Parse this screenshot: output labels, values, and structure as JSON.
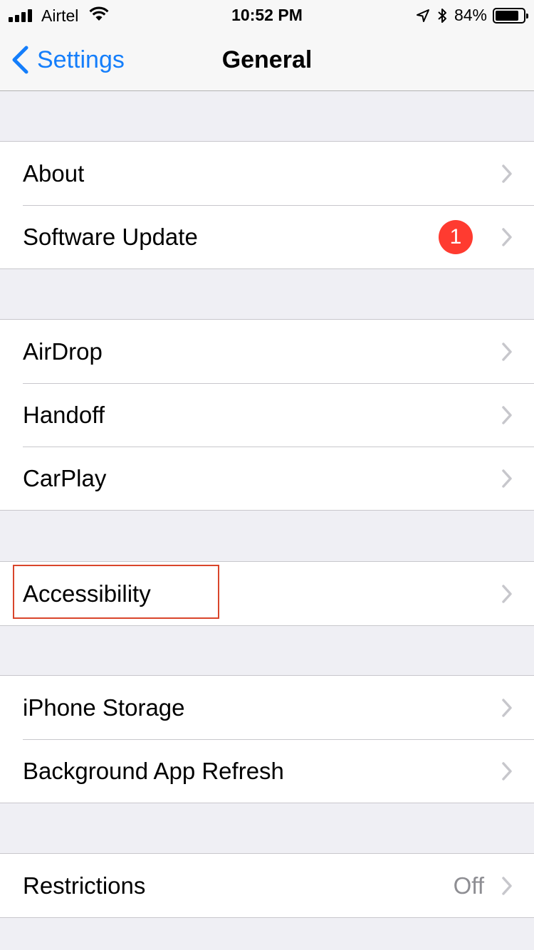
{
  "status_bar": {
    "carrier": "Airtel",
    "time": "10:52 PM",
    "battery_percent": "84%",
    "battery_level": 0.84,
    "icons": [
      "signal-icon",
      "wifi-icon",
      "location-icon",
      "bluetooth-icon",
      "battery-icon"
    ]
  },
  "nav": {
    "back_label": "Settings",
    "title": "General"
  },
  "groups": [
    {
      "items": [
        {
          "label": "About"
        },
        {
          "label": "Software Update",
          "badge": "1"
        }
      ]
    },
    {
      "items": [
        {
          "label": "AirDrop"
        },
        {
          "label": "Handoff"
        },
        {
          "label": "CarPlay"
        }
      ]
    },
    {
      "items": [
        {
          "label": "Accessibility",
          "highlighted": true
        }
      ]
    },
    {
      "items": [
        {
          "label": "iPhone Storage"
        },
        {
          "label": "Background App Refresh"
        }
      ]
    },
    {
      "items": [
        {
          "label": "Restrictions",
          "value": "Off"
        }
      ]
    }
  ],
  "colors": {
    "accent": "#147efb",
    "badge": "#ff3b30",
    "background": "#efeff4",
    "highlight": "#d9452b"
  }
}
